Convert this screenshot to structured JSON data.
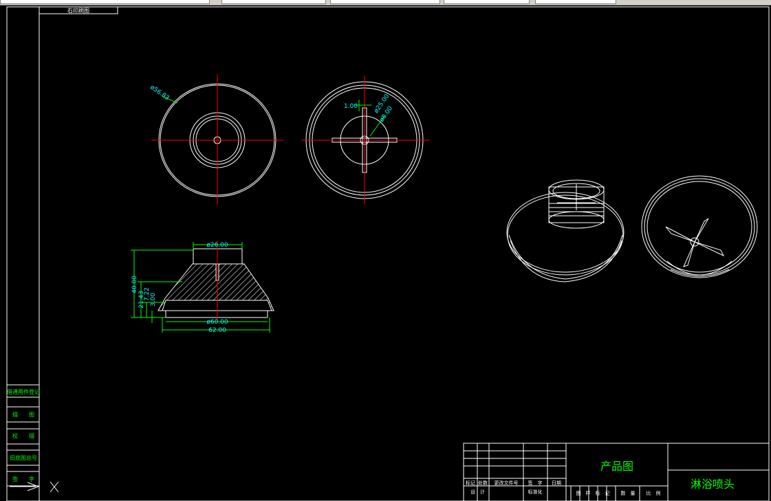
{
  "window": {
    "tab_label": "石印刷图"
  },
  "front_view": {
    "dia_outer": "ø56.83"
  },
  "bottom_view": {
    "dim_gap": "1.00",
    "dia_mid": "ø25.00",
    "dia_hole": "ø8.00"
  },
  "section_view": {
    "dia_top": "ø26.00",
    "height_total": "40.00",
    "height_mid": "21.43",
    "height_small": "7.22",
    "height_base": "3.00",
    "dia_base": "ø60.00",
    "width_total": "62.00"
  },
  "left_strip": {
    "labels": [
      "借通用件登记",
      "描　　图",
      "校　　描",
      "旧底图总号",
      "签　　字"
    ]
  },
  "title_block": {
    "drawing_type": "产品图",
    "product_name": "淋浴喷头",
    "rev_headers": [
      "标记",
      "处数",
      "更改文件号",
      "签　字",
      "日期"
    ],
    "row_labels": [
      "设　计",
      "标准化"
    ],
    "bottom_headers": [
      "图　样　标　记",
      "数　量",
      "比　例"
    ]
  },
  "colors": {
    "line": "#ffffff",
    "center": "#ff0000",
    "dimension": "#00ff00",
    "dim_text": "#00ffff",
    "block_text": "#00ff00"
  },
  "icons": {
    "ucs": "ucs-icon"
  }
}
